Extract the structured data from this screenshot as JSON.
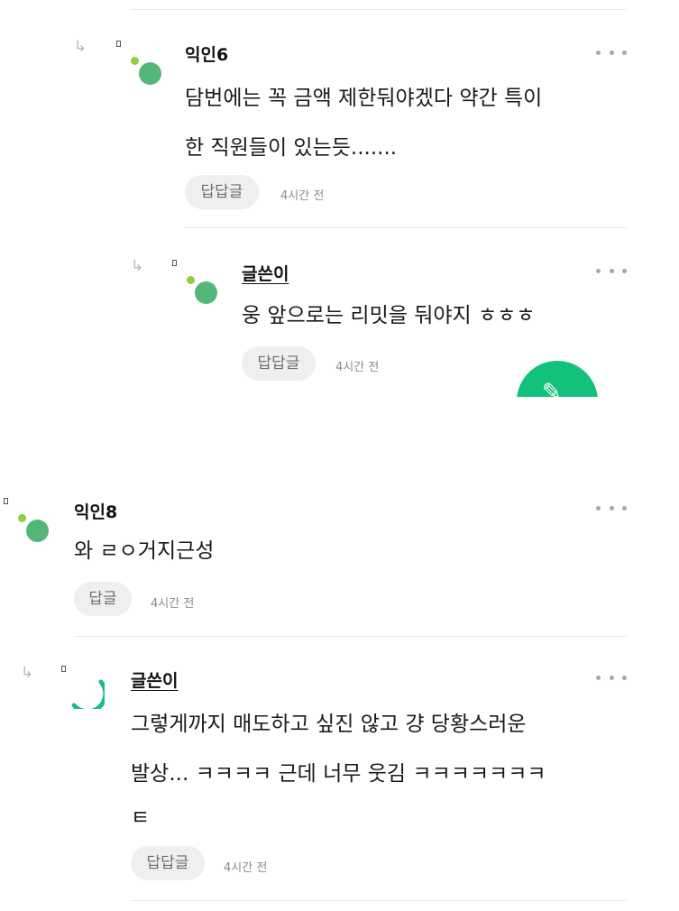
{
  "top": {
    "comment": {
      "author": "익인6",
      "text_line1": "담번에는 꼭 금액 제한둬야겠다 약간 특이",
      "text_line2": "한 직원들이 있는듯.......",
      "reply_label": "답답글",
      "time": "4시간 전"
    },
    "reply": {
      "author": "글쓴이",
      "text_line1": "웅 앞으로는 리밋을 둬야지 ㅎㅎㅎ",
      "reply_label": "답답글",
      "time": "4시간 전"
    },
    "fab_icon": "write-icon"
  },
  "bottom": {
    "comment": {
      "author": "익인8",
      "text_line1": "와 ㄹㅇ거지근성",
      "reply_label": "답글",
      "time": "4시간 전"
    },
    "reply": {
      "author": "글쓴이",
      "text_line1": "그렇게까지 매도하고 싶진 않고 걍 당황스러운",
      "text_line2": "발상... ㅋㅋㅋㅋ 근데 너무 웃김 ㅋㅋㅋㅋㅋㅋㅋ",
      "text_line3": "ㅌ",
      "reply_label": "답답글",
      "time": "4시간 전"
    }
  },
  "colors": {
    "accent": "#13c27a",
    "avatar_green": "#55b67a",
    "avatar_lime": "#8ecf3a",
    "muted": "#8a8a8a"
  }
}
